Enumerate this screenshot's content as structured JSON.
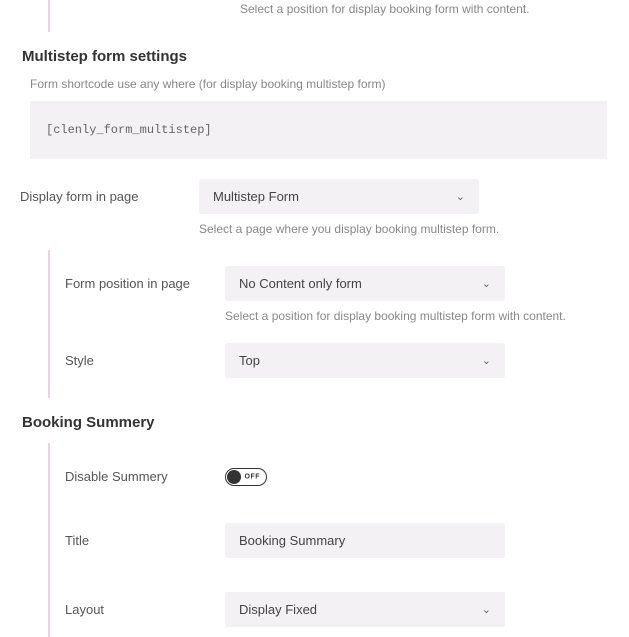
{
  "top_hint": "Select a position for display booking form with content.",
  "multistep": {
    "heading": "Multistep form settings",
    "note": "Form shortcode use any where (for display booking multistep form)",
    "shortcode": "[clenly_form_multistep]",
    "display_page": {
      "label": "Display form in page",
      "value": "Multistep Form",
      "hint": "Select a page where you display booking multistep form."
    },
    "position": {
      "label": "Form position in page",
      "value": "No Content only form",
      "hint": "Select a position for display booking multistep form with content."
    },
    "style": {
      "label": "Style",
      "value": "Top"
    }
  },
  "summary": {
    "heading": "Booking Summery",
    "disable": {
      "label": "Disable Summery",
      "state": "OFF"
    },
    "title": {
      "label": "Title",
      "value": "Booking Summary"
    },
    "layout": {
      "label": "Layout",
      "value": "Display Fixed"
    }
  }
}
